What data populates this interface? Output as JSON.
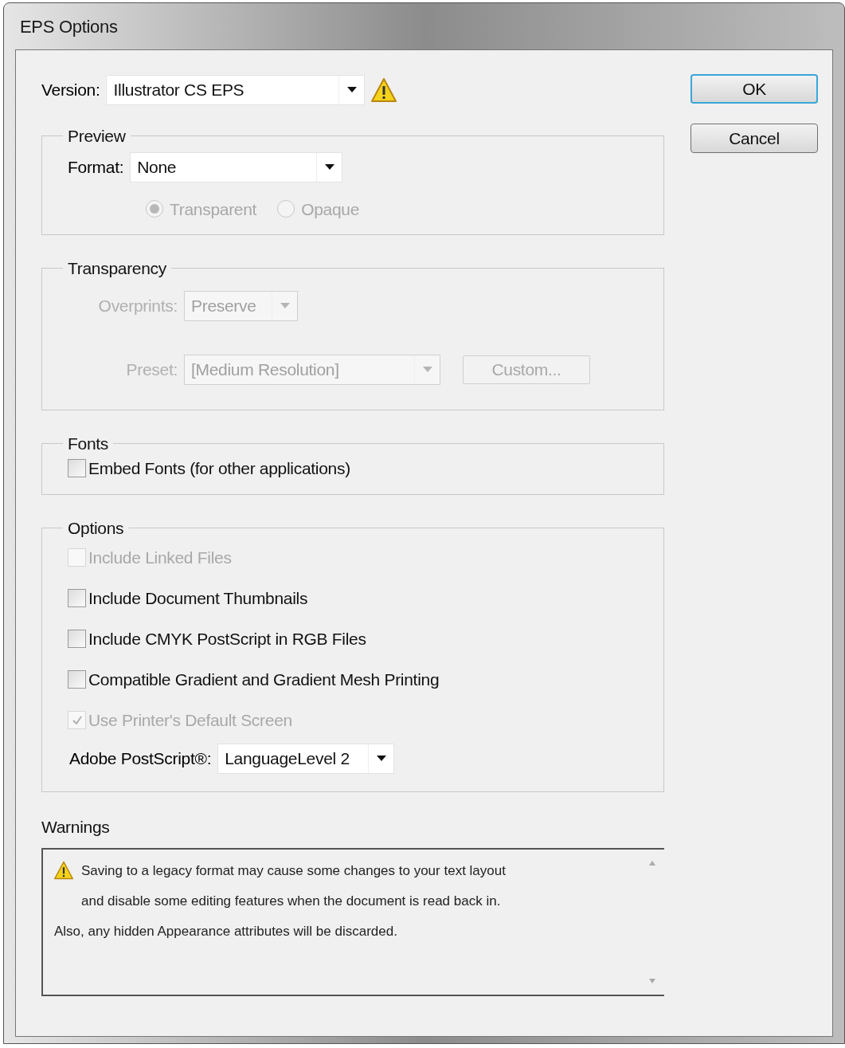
{
  "window": {
    "title": "EPS Options"
  },
  "version": {
    "label": "Version:",
    "value": "Illustrator CS EPS",
    "warning": true
  },
  "preview": {
    "title": "Preview",
    "format_label": "Format:",
    "format_value": "None",
    "radios": [
      {
        "label": "Transparent",
        "selected": true,
        "disabled": true
      },
      {
        "label": "Opaque",
        "selected": false,
        "disabled": true
      }
    ]
  },
  "transparency": {
    "title": "Transparency",
    "disabled": true,
    "overprints_label": "Overprints:",
    "overprints_value": "Preserve",
    "preset_label": "Preset:",
    "preset_value": "[Medium Resolution]",
    "custom_button": "Custom..."
  },
  "fonts": {
    "title": "Fonts",
    "checkboxes": [
      {
        "label": "Embed Fonts (for other applications)",
        "checked": false,
        "disabled": false
      }
    ]
  },
  "options": {
    "title": "Options",
    "checkboxes": [
      {
        "label": "Include Linked Files",
        "checked": false,
        "disabled": true
      },
      {
        "label": "Include Document Thumbnails",
        "checked": false,
        "disabled": false
      },
      {
        "label": "Include CMYK PostScript in RGB Files",
        "checked": false,
        "disabled": false
      },
      {
        "label": "Compatible Gradient and Gradient Mesh Printing",
        "checked": false,
        "disabled": false
      },
      {
        "label": "Use Printer's Default Screen",
        "checked": true,
        "disabled": true
      }
    ],
    "postscript_label": "Adobe PostScript®:",
    "postscript_value": "LanguageLevel 2"
  },
  "warnings": {
    "title": "Warnings",
    "messages": [
      "Saving to a legacy format may cause some changes to your text layout and disable some editing features when the document is read back in.",
      "Also, any hidden Appearance attributes will be discarded."
    ]
  },
  "buttons": [
    {
      "label": "OK",
      "default": true
    },
    {
      "label": "Cancel",
      "default": false
    }
  ]
}
